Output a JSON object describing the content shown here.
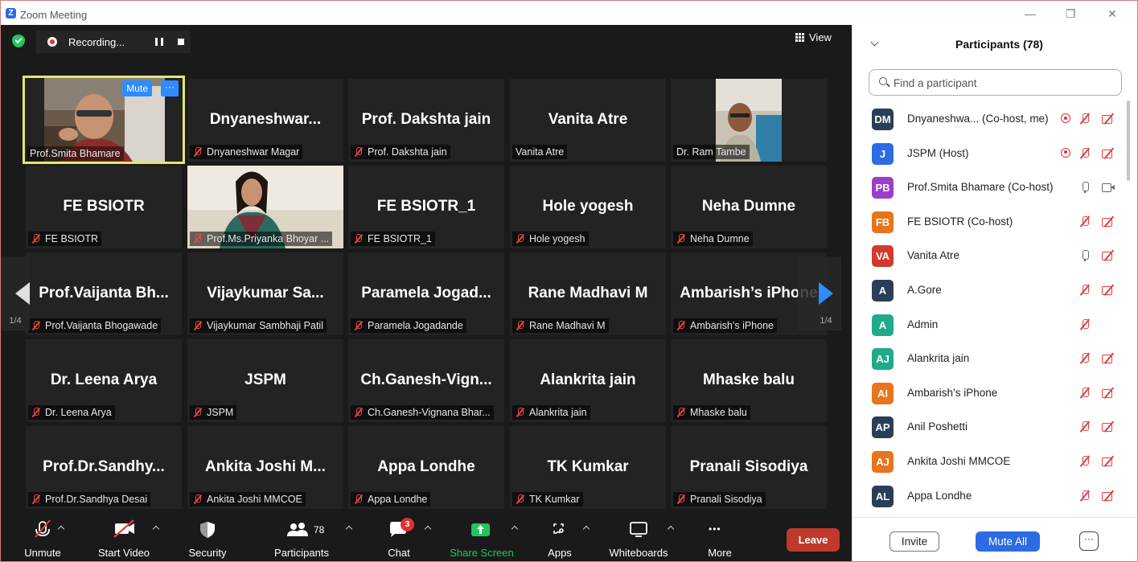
{
  "window": {
    "title": "Zoom Meeting",
    "logo_letter": "Z",
    "minimize": "—",
    "restore": "❐",
    "close": "✕"
  },
  "recording": {
    "label": "Recording..."
  },
  "view_button": {
    "label": "View"
  },
  "active_tile": {
    "name": "Prof.Smita Bhamare",
    "mute_label": "Mute",
    "more_label": "···"
  },
  "tiles": [
    {
      "big": "Dnyaneshwar...",
      "label": "Dnyaneshwar Magar",
      "muted": true
    },
    {
      "big": "Prof. Dakshta jain",
      "label": "Prof. Dakshta jain",
      "muted": true
    },
    {
      "big": "Vanita Atre",
      "label": "Vanita Atre",
      "muted": false
    },
    {
      "big": "",
      "label": "Dr. Ram Tambe",
      "muted": false,
      "photo": true
    },
    {
      "big": "FE BSIOTR",
      "label": "FE BSIOTR",
      "muted": true
    },
    {
      "big": "",
      "label": "Prof.Ms.Priyanka Bhoyar ...",
      "muted": true,
      "photo": true
    },
    {
      "big": "FE BSIOTR_1",
      "label": "FE BSIOTR_1",
      "muted": true
    },
    {
      "big": "Hole yogesh",
      "label": "Hole yogesh",
      "muted": true
    },
    {
      "big": "Neha Dumne",
      "label": "Neha Dumne",
      "muted": true
    },
    {
      "big": "Prof.Vaijanta  Bh...",
      "label": "Prof.Vaijanta Bhogawade",
      "muted": true
    },
    {
      "big": "Vijaykumar  Sa...",
      "label": "Vijaykumar Sambhaji Patil",
      "muted": true
    },
    {
      "big": "Paramela  Jogad...",
      "label": "Paramela Jogadande",
      "muted": true
    },
    {
      "big": "Rane Madhavi M",
      "label": "Rane Madhavi M",
      "muted": true
    },
    {
      "big": "Ambarish’s iPhone",
      "label": "Ambarish’s iPhone",
      "muted": true
    },
    {
      "big": "Dr. Leena Arya",
      "label": "Dr. Leena Arya",
      "muted": true
    },
    {
      "big": "JSPM",
      "label": "JSPM",
      "muted": true
    },
    {
      "big": "Ch.Ganesh-Vign...",
      "label": "Ch.Ganesh-Vignana Bhar...",
      "muted": true
    },
    {
      "big": "Alankrita jain",
      "label": "Alankrita jain",
      "muted": true
    },
    {
      "big": "Mhaske balu",
      "label": "Mhaske balu",
      "muted": true
    },
    {
      "big": "Prof.Dr.Sandhy...",
      "label": "Prof.Dr.Sandhya Desai",
      "muted": true
    },
    {
      "big": "Ankita Joshi M...",
      "label": "Ankita Joshi MMCOE",
      "muted": true
    },
    {
      "big": "Appa Londhe",
      "label": "Appa Londhe",
      "muted": true
    },
    {
      "big": "TK Kumkar",
      "label": "TK Kumkar",
      "muted": true
    },
    {
      "big": "Pranali Sisodiya",
      "label": "Pranali Sisodiya",
      "muted": true
    }
  ],
  "pager": {
    "left": "1/4",
    "right": "1/4"
  },
  "toolbar": {
    "unmute": "Unmute",
    "start_video": "Start Video",
    "security": "Security",
    "participants": "Participants",
    "participants_count": "78",
    "chat": "Chat",
    "chat_badge": "3",
    "share_screen": "Share Screen",
    "apps": "Apps",
    "whiteboards": "Whiteboards",
    "more": "More",
    "more_dots": "•••",
    "leave": "Leave"
  },
  "panel": {
    "title": "Participants (78)",
    "search_placeholder": "Find a participant",
    "invite": "Invite",
    "mute_all": "Mute All",
    "more": "···"
  },
  "participants": [
    {
      "initials": "DM",
      "name": "Dnyaneshwa...  (Co-host, me)",
      "color": "#2b3e57",
      "rec": true,
      "mic": "off",
      "video": "off"
    },
    {
      "initials": "J",
      "name": "JSPM (Host)",
      "color": "#2d6be4",
      "rec": true,
      "mic": "off",
      "video": "off"
    },
    {
      "initials": "PB",
      "name": "Prof.Smita Bhamare (Co-host)",
      "color": "#9b3ec8",
      "rec": false,
      "mic": "on",
      "video": "on"
    },
    {
      "initials": "FB",
      "name": "FE BSIOTR (Co-host)",
      "color": "#e8741c",
      "rec": false,
      "mic": "off",
      "video": "off"
    },
    {
      "initials": "VA",
      "name": "Vanita Atre",
      "color": "#d23a2e",
      "rec": false,
      "mic": "on",
      "video": "off"
    },
    {
      "initials": "A",
      "name": "A.Gore",
      "color": "#2b3e57",
      "rec": false,
      "mic": "off",
      "video": "off"
    },
    {
      "initials": "A",
      "name": "Admin",
      "color": "#1faa8a",
      "rec": false,
      "mic": "off",
      "video": "none"
    },
    {
      "initials": "AJ",
      "name": "Alankrita jain",
      "color": "#1faa8a",
      "rec": false,
      "mic": "off",
      "video": "off"
    },
    {
      "initials": "AI",
      "name": "Ambarish’s iPhone",
      "color": "#e8741c",
      "rec": false,
      "mic": "off",
      "video": "off"
    },
    {
      "initials": "AP",
      "name": "Anil Poshetti",
      "color": "#2b3e57",
      "rec": false,
      "mic": "off",
      "video": "off"
    },
    {
      "initials": "AJ",
      "name": "Ankita Joshi MMCOE",
      "color": "#e8741c",
      "rec": false,
      "mic": "off",
      "video": "off"
    },
    {
      "initials": "AL",
      "name": "Appa Londhe",
      "color": "#2b3e57",
      "rec": false,
      "mic": "off",
      "video": "off"
    },
    {
      "initials": "",
      "name": "",
      "color": "#e8a01c",
      "rec": false,
      "mic": "none",
      "video": "none"
    }
  ]
}
